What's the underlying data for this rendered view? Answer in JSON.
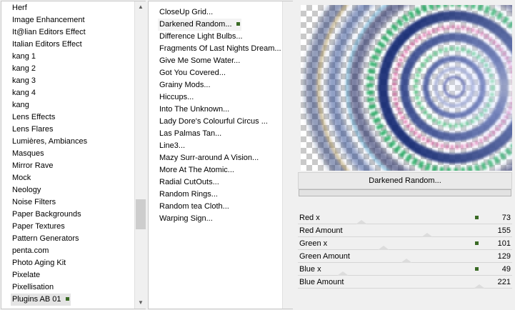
{
  "categories": {
    "items": [
      "Herf",
      "Image Enhancement",
      "It@lian Editors Effect",
      "Italian Editors Effect",
      "kang 1",
      "kang 2",
      "kang 3",
      "kang 4",
      "kang",
      "Lens Effects",
      "Lens Flares",
      "Lumières, Ambiances",
      "Masques",
      "Mirror Rave",
      "Mock",
      "Neology",
      "Noise Filters",
      "Paper Backgrounds",
      "Paper Textures",
      "Pattern Generators",
      "penta.com",
      "Photo Aging Kit",
      "Pixelate",
      "Pixellisation",
      "Plugins AB 01"
    ],
    "selected_index": 24,
    "scroll": {
      "up_icon": "chevron-up-icon",
      "down_icon": "chevron-down-icon"
    }
  },
  "filters": {
    "items": [
      "CloseUp Grid...",
      "Darkened Random...",
      "Difference Light Bulbs...",
      "Fragments Of Last Nights Dream...",
      "Give Me Some Water...",
      "Got You Covered...",
      "Grainy Mods...",
      "Hiccups...",
      "Into The Unknown...",
      "Lady Dore's Colourful Circus ...",
      "Las Palmas Tan...",
      "Line3...",
      "Mazy Surr-around A Vision...",
      "More At The Atomic...",
      "Radial CutOuts...",
      "Random Rings...",
      "Random tea Cloth...",
      "Warping Sign..."
    ],
    "selected_index": 1
  },
  "preview": {
    "filter_name": "Darkened Random..."
  },
  "params": [
    {
      "label": "Red x",
      "value": "73",
      "level": 0.286
    },
    {
      "label": "Red Amount",
      "value": "155",
      "level": 0.608
    },
    {
      "label": "Green x",
      "value": "101",
      "level": 0.396
    },
    {
      "label": "Green Amount",
      "value": "129",
      "level": 0.506
    },
    {
      "label": "Blue x",
      "value": "49",
      "level": 0.192
    },
    {
      "label": "Blue Amount",
      "value": "221",
      "level": 0.867
    }
  ],
  "colors": {
    "accent_marker": "#3a6b25"
  }
}
